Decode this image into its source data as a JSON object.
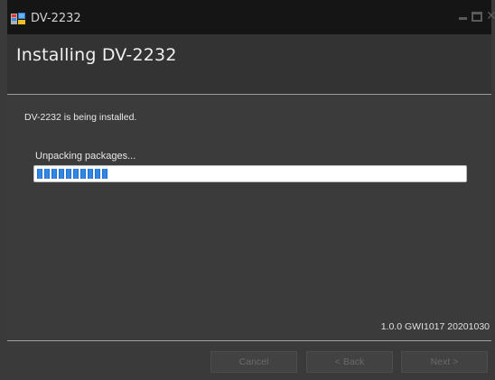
{
  "window": {
    "title": "DV-2232",
    "icon": "installer-app-icon"
  },
  "header": {
    "heading": "Installing DV-2232"
  },
  "content": {
    "status_text": "DV-2232 is being installed.",
    "step_text": "Unpacking packages...",
    "progress": {
      "fraction": 0.17,
      "fill_color": "#1f6fd1"
    },
    "version": "1.0.0 GWI1017 20201030"
  },
  "footer": {
    "cancel_label": "Cancel",
    "back_label": "< Back",
    "next_label": "Next >"
  },
  "colors": {
    "titlebar_bg": "#151515",
    "window_bg": "#3a3a3a",
    "divider": "#9a9a9a",
    "disabled_text": "#6a6a6a"
  }
}
